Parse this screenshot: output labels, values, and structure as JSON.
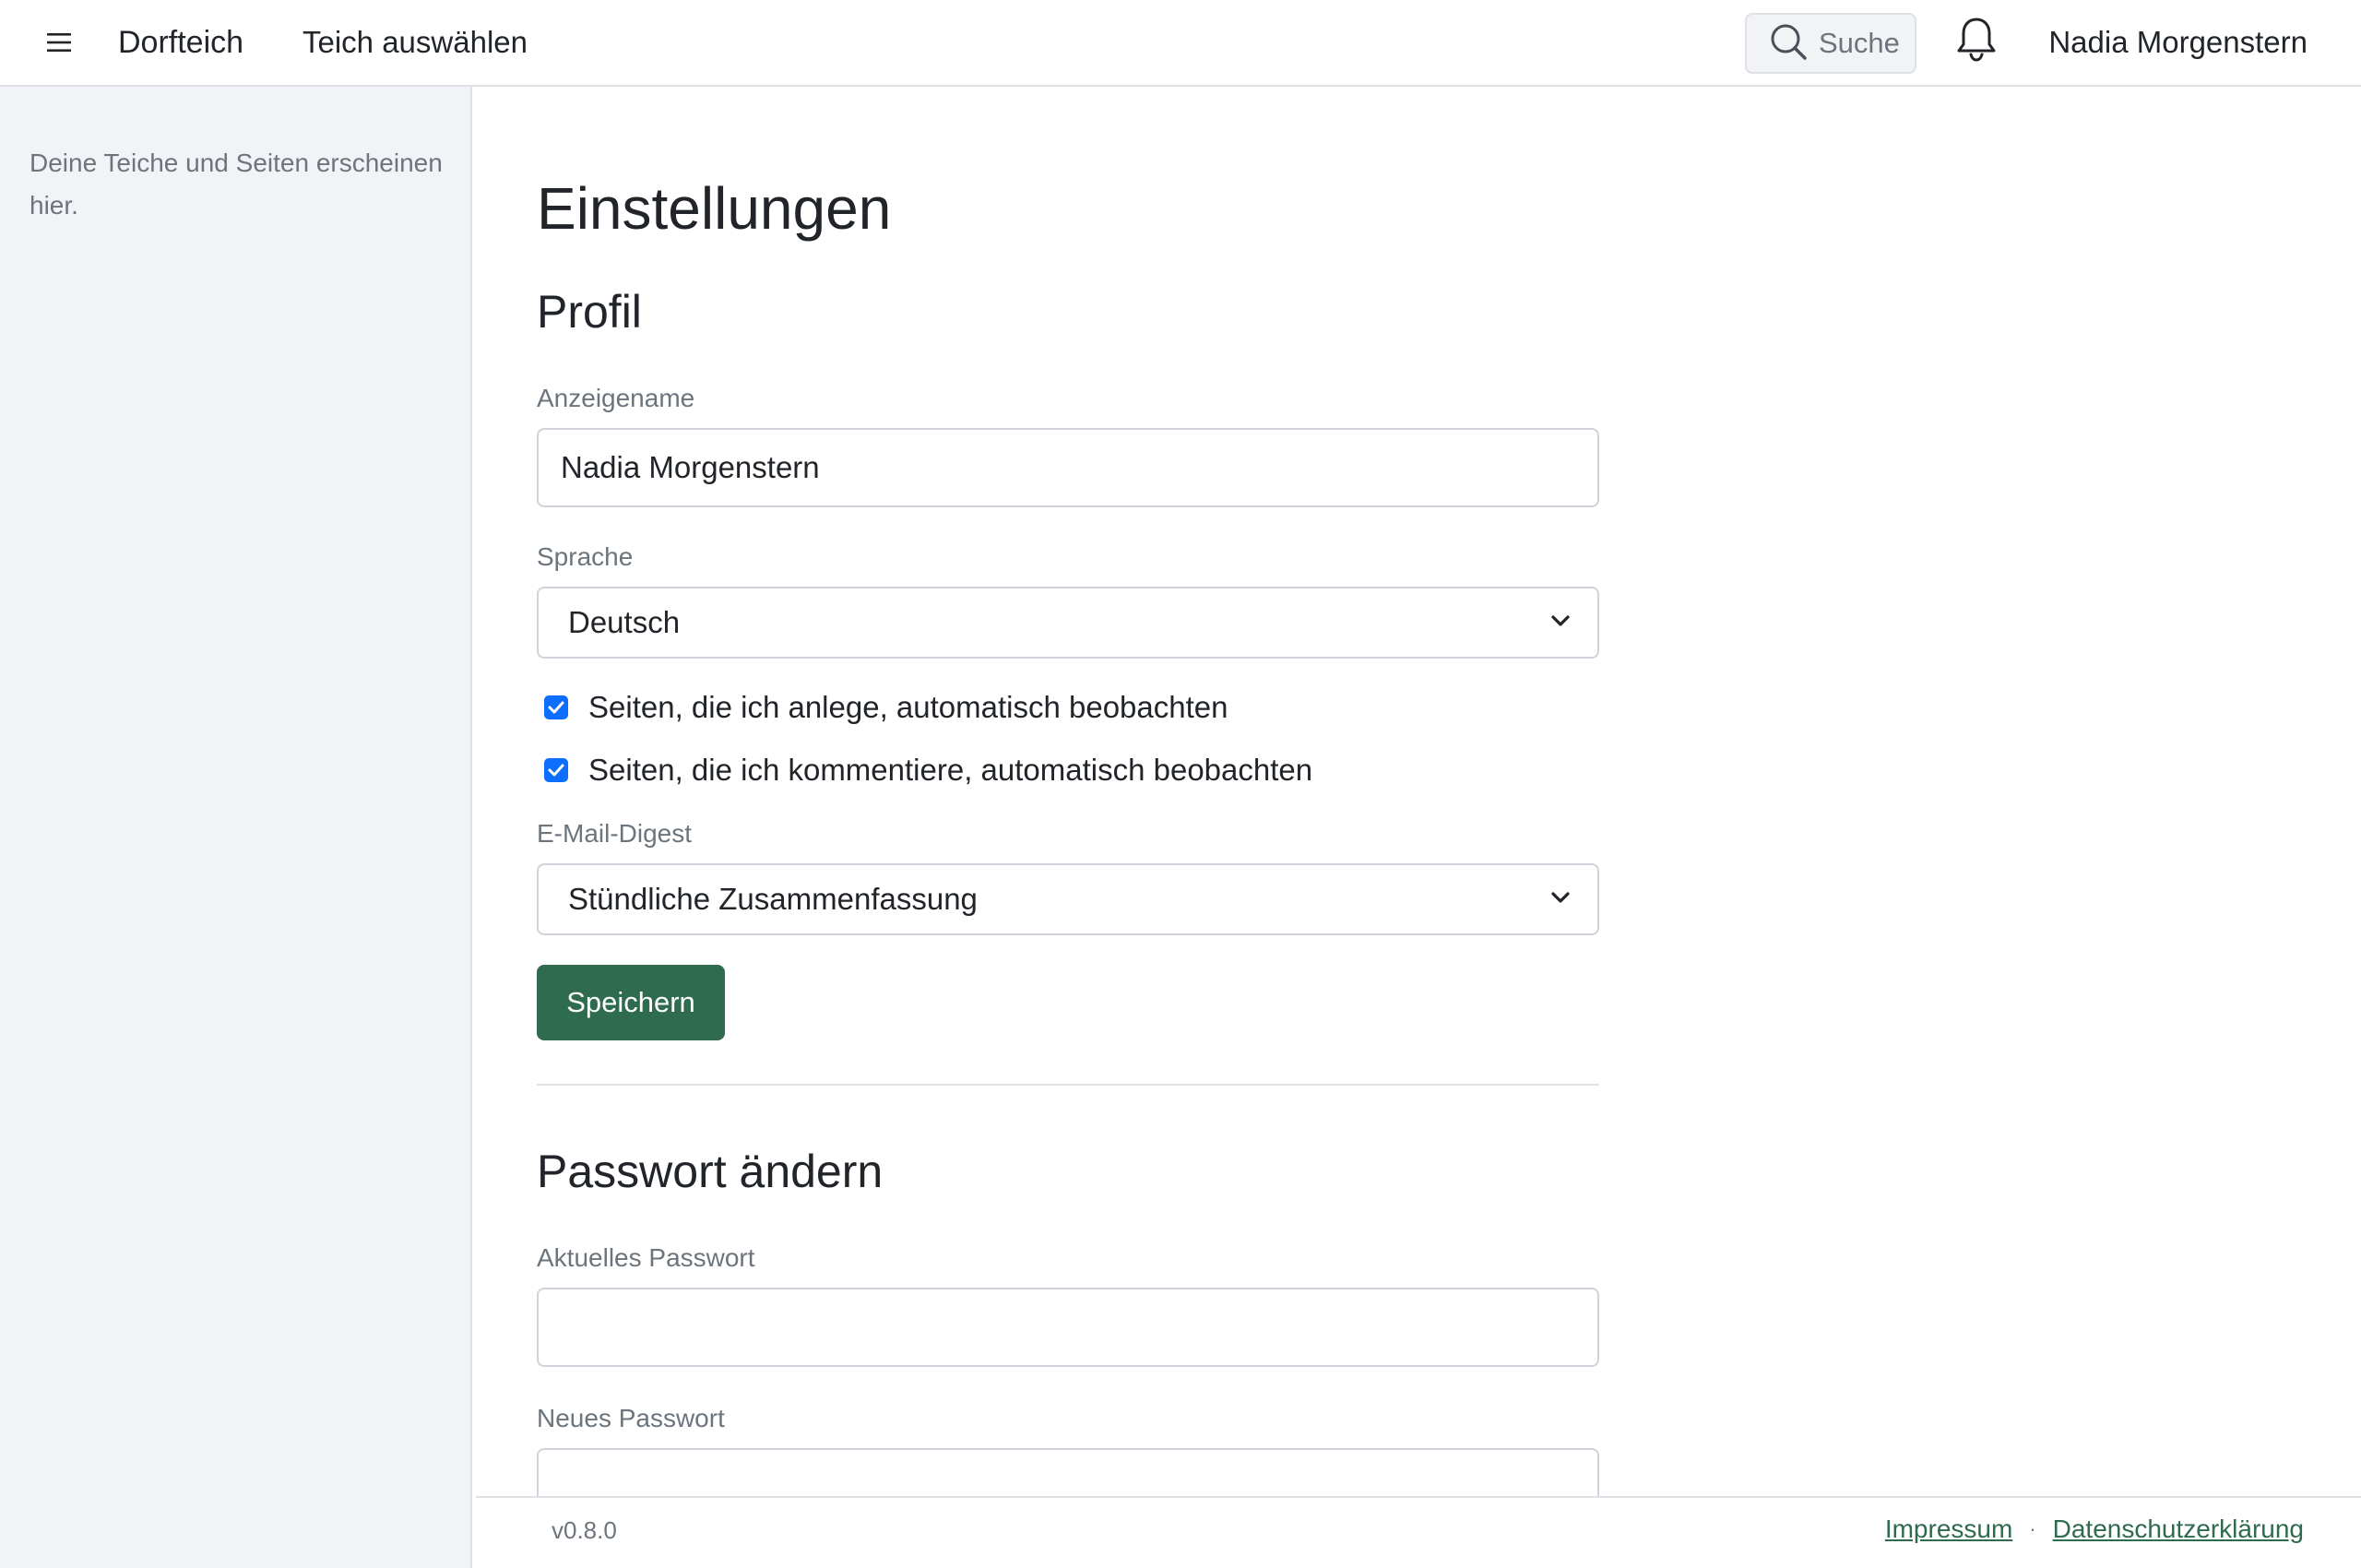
{
  "header": {
    "brand": "Dorfteich",
    "pond_select": "Teich auswählen",
    "search_label": "Suche",
    "user_name": "Nadia Morgenstern"
  },
  "sidebar": {
    "empty_text": "Deine Teiche und Seiten erscheinen hier."
  },
  "main": {
    "page_title": "Einstellungen",
    "profile": {
      "title": "Profil",
      "display_name_label": "Anzeigename",
      "display_name_value": "Nadia Morgenstern",
      "language_label": "Sprache",
      "language_value": "Deutsch",
      "watch_created_label": "Seiten, die ich anlege, automatisch beobachten",
      "watch_created_checked": true,
      "watch_commented_label": "Seiten, die ich kommentiere, automatisch beobachten",
      "watch_commented_checked": true,
      "digest_label": "E-Mail-Digest",
      "digest_value": "Stündliche Zusammenfassung",
      "save_label": "Speichern"
    },
    "password": {
      "title": "Passwort ändern",
      "current_label": "Aktuelles Passwort",
      "current_value": "",
      "new_label": "Neues Passwort",
      "new_value": ""
    }
  },
  "footer": {
    "version": "v0.8.0",
    "imprint": "Impressum",
    "separator": "·",
    "privacy": "Datenschutzerklärung"
  },
  "colors": {
    "accent": "#2f6b4f",
    "checkbox": "#0d6efd",
    "sidebar_bg": "#f1f3f7"
  }
}
